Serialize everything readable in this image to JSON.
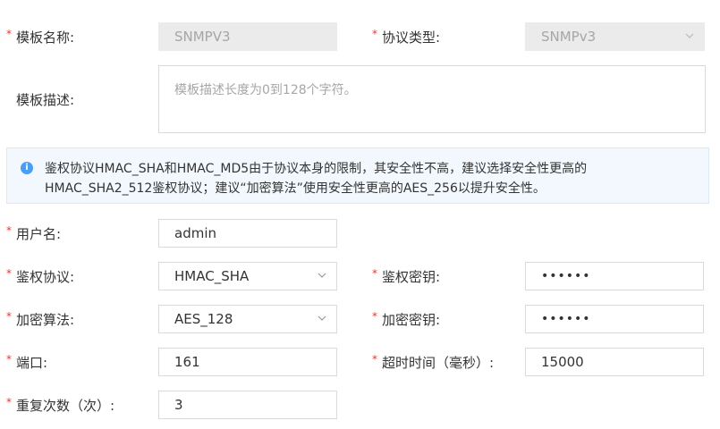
{
  "template_name": {
    "label": "模板名称:",
    "value": "SNMPV3"
  },
  "protocol_type": {
    "label": "协议类型:",
    "value": "SNMPv3"
  },
  "template_desc": {
    "label": "模板描述:",
    "placeholder": "模板描述长度为0到128个字符。"
  },
  "notice": {
    "line1": "鉴权协议HMAC_SHA和HMAC_MD5由于协议本身的限制，其安全性不高，建议选择安全性更高的",
    "line2": "HMAC_SHA2_512鉴权协议；建议“加密算法”使用安全性更高的AES_256以提升安全性。"
  },
  "username": {
    "label": "用户名:",
    "value": "admin"
  },
  "auth_protocol": {
    "label": "鉴权协议:",
    "value": "HMAC_SHA"
  },
  "auth_key": {
    "label": "鉴权密钥:",
    "value": "••••••"
  },
  "encrypt_algo": {
    "label": "加密算法:",
    "value": "AES_128"
  },
  "encrypt_key": {
    "label": "加密密钥:",
    "value": "••••••"
  },
  "port": {
    "label": "端口:",
    "value": "161"
  },
  "timeout": {
    "label": "超时时间（毫秒）:",
    "value": "15000"
  },
  "retries": {
    "label": "重复次数（次）:",
    "value": "3"
  },
  "required_mark": "*"
}
